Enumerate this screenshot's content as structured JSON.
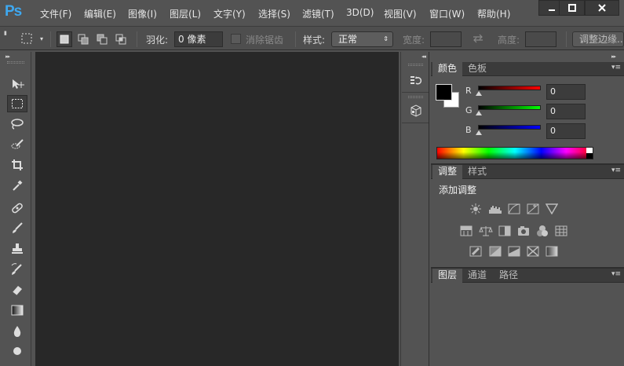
{
  "app": {
    "logo": "Ps",
    "menu": [
      "文件(F)",
      "编辑(E)",
      "图像(I)",
      "图层(L)",
      "文字(Y)",
      "选择(S)",
      "滤镜(T)",
      "3D(D)",
      "视图(V)",
      "窗口(W)",
      "帮助(H)"
    ]
  },
  "options_bar": {
    "feather_label": "羽化:",
    "feather_value": "0 像素",
    "antialias_label": "消除锯齿",
    "style_label": "样式:",
    "style_value": "正常",
    "width_label": "宽度:",
    "height_label": "高度:",
    "refine_edge_label": "调整边缘..."
  },
  "panels": {
    "color": {
      "tabs": [
        "颜色",
        "色板"
      ],
      "channels": [
        {
          "label": "R",
          "value": "0",
          "color": "#ff0000"
        },
        {
          "label": "G",
          "value": "0",
          "color": "#00ff00"
        },
        {
          "label": "B",
          "value": "0",
          "color": "#0000ff"
        }
      ],
      "foreground": "#000000",
      "background": "#ffffff"
    },
    "adjustments": {
      "tabs": [
        "调整",
        "样式"
      ],
      "title": "添加调整"
    },
    "layers": {
      "tabs": [
        "图层",
        "通道",
        "路径"
      ]
    }
  },
  "icons": {
    "tools": [
      "move-icon",
      "marquee-icon",
      "lasso-icon",
      "quick-select-icon",
      "crop-icon",
      "eyedropper-icon",
      "healing-icon",
      "brush-icon",
      "stamp-icon",
      "history-brush-icon",
      "eraser-icon",
      "gradient-icon",
      "blur-icon",
      "dodge-icon"
    ],
    "dock": [
      "history-icon",
      "3d-icon"
    ]
  },
  "colors": {
    "ui_bg": "#535353",
    "canvas_bg": "#282828",
    "logo": "#3ea8f0"
  }
}
